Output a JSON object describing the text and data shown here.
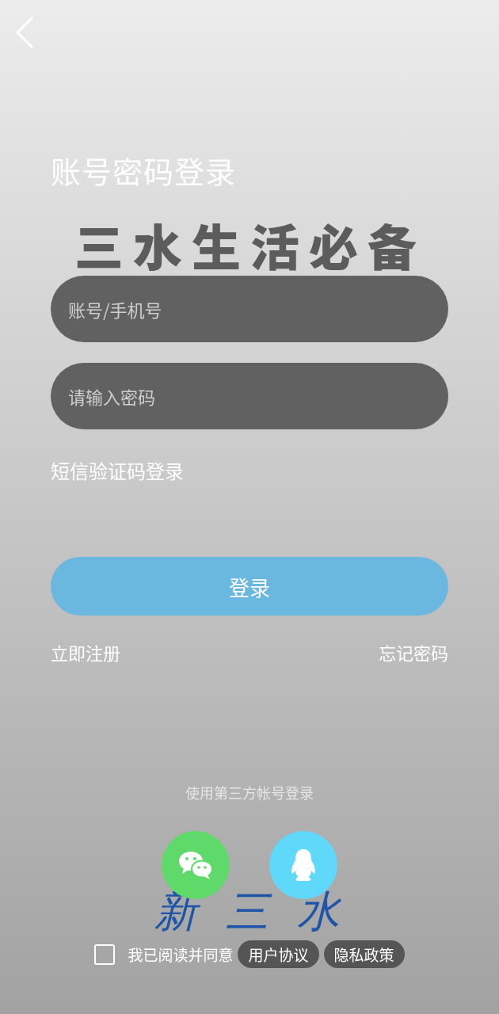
{
  "title": "账号密码登录",
  "slogan": "三水生活必备",
  "fields": [
    {
      "placeholder": "账号/手机号"
    },
    {
      "placeholder": "请输入密码"
    }
  ],
  "sms_login_link": "短信验证码登录",
  "login_button": "登录",
  "register_link": "立即注册",
  "forgot_link": "忘记密码",
  "third_party": {
    "label": "使用第三方帐号登录"
  },
  "brand_logo": "新三水",
  "agreement": {
    "checked": false,
    "text": "我已阅读并同意",
    "links": [
      "用户协议",
      "隐私政策"
    ]
  }
}
